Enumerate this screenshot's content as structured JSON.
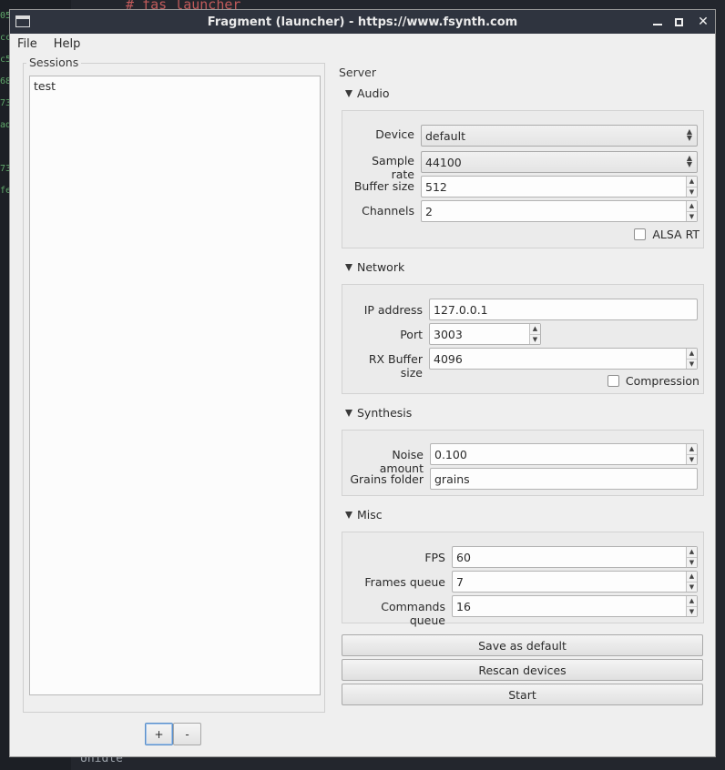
{
  "background": {
    "code_line": "# fas launcher",
    "bottom_text": "Unidte",
    "side_fragments": [
      "05",
      "cc",
      "c5",
      "68",
      "73",
      "ad",
      "73",
      "fe"
    ]
  },
  "window": {
    "title": "Fragment (launcher) - https://www.fsynth.com",
    "controls": {
      "close": "✕"
    }
  },
  "menu": [
    "File",
    "Help"
  ],
  "sessions": {
    "title": "Sessions",
    "items": [
      "test"
    ],
    "add_label": "+",
    "remove_label": "-"
  },
  "server": {
    "title": "Server",
    "audio": {
      "title": "Audio",
      "device_label": "Device",
      "device_value": "default",
      "samplerate_label": "Sample rate",
      "samplerate_value": "44100",
      "buffer_label": "Buffer size",
      "buffer_value": "512",
      "channels_label": "Channels",
      "channels_value": "2",
      "alsa_label": "ALSA RT",
      "alsa_checked": false
    },
    "network": {
      "title": "Network",
      "ip_label": "IP address",
      "ip_value": "127.0.0.1",
      "port_label": "Port",
      "port_value": "3003",
      "rx_label": "RX Buffer size",
      "rx_value": "4096",
      "compression_label": "Compression",
      "compression_checked": false
    },
    "synthesis": {
      "title": "Synthesis",
      "noise_label": "Noise amount",
      "noise_value": "0.100",
      "grains_label": "Grains folder",
      "grains_value": "grains"
    },
    "misc": {
      "title": "Misc",
      "fps_label": "FPS",
      "fps_value": "60",
      "frames_label": "Frames queue",
      "frames_value": "7",
      "commands_label": "Commands queue",
      "commands_value": "16"
    },
    "buttons": {
      "save_default": "Save as default",
      "rescan": "Rescan devices",
      "start": "Start"
    }
  }
}
